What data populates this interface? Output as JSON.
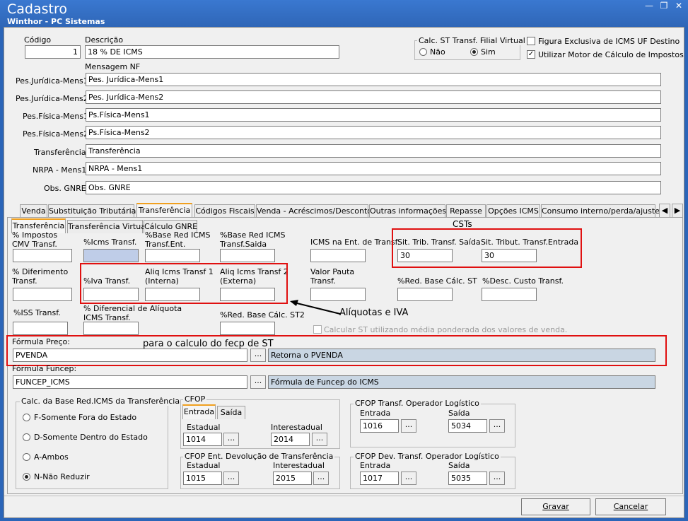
{
  "window": {
    "title": "Cadastro",
    "subtitle": "Winthor - PC Sistemas",
    "minimize": "—",
    "restore": "❐",
    "close": "✕"
  },
  "header": {
    "codigo_label": "Código",
    "codigo_value": "1",
    "descricao_label": "Descrição",
    "descricao_value": "18 % DE ICMS",
    "calc_st_label": "Calc. ST Transf. Filial Virtual",
    "nao_label": "Não",
    "sim_label": "Sim",
    "figura_label": "Figura Exclusiva de ICMS UF Destino",
    "motor_label": "Utilizar Motor de Cálculo de Impostos",
    "check_mark": "✓"
  },
  "mensagens": {
    "title": "Mensagem NF",
    "rows": [
      {
        "label": "Pes.Jurídica-Mens1",
        "value": "Pes. Jurídica-Mens1"
      },
      {
        "label": "Pes.Jurídica-Mens2",
        "value": "Pes. Jurídica-Mens2"
      },
      {
        "label": "Pes.Física-Mens1",
        "value": "Ps.Física-Mens1"
      },
      {
        "label": "Pes.Física-Mens2",
        "value": "Ps.Física-Mens2"
      },
      {
        "label": "Transferência",
        "value": "Transferência"
      },
      {
        "label": "NRPA - Mens1",
        "value": "NRPA - Mens1"
      },
      {
        "label": "Obs. GNRE",
        "value": "Obs. GNRE"
      }
    ]
  },
  "main_tabs": [
    "Venda",
    "Substituição Tributária",
    "Transferência",
    "Códigos Fiscais",
    "Venda - Acréscimos/Descontos",
    "Outras informações",
    "Repasse",
    "Opções ICMS",
    "Consumo interno/perda/ajuste"
  ],
  "scroll": {
    "left": "◀",
    "right": "▶"
  },
  "sub_tabs": [
    "Transferência",
    "Transferência Virtual",
    "Cálculo GNRE"
  ],
  "fields": {
    "impostos_cmv": "% Impostos\nCMV Transf.",
    "icms_transf": "%Icms Transf.",
    "base_red_ent": "%Base Red ICMS\nTransf.Ent.",
    "base_red_saida": "%Base Red ICMS\nTransf.Saida",
    "icms_ent": "ICMS na Ent. de Transf.",
    "sit_trib_saida": "Sit. Trib. Transf. Saída",
    "sit_trib_saida_value": "30",
    "sit_trib_entrada": "Sit. Tribut. Transf.Entrada",
    "sit_trib_entrada_value": "30",
    "diferimento": "% Diferimento\nTransf.",
    "iva_transf": "%Iva Transf.",
    "aliq_interna": "Aliq Icms Transf 1\n(Interna)",
    "aliq_externa": "Aliq Icms Transf 2\n(Externa)",
    "valor_pauta": "Valor Pauta\nTransf.",
    "red_base_st": "%Red. Base Cálc. ST",
    "desc_custo": "%Desc. Custo Transf.",
    "iss_transf": "%ISS  Transf.",
    "diferencial": "% Diferencial de Alíquota\nICMS Transf.",
    "red_base_st2": "%Red. Base Cálc. ST2",
    "calc_st_media": "Calcular ST utilizando média ponderada dos valores de venda."
  },
  "annotations": {
    "csts": "CSTs",
    "aliquotas": "Alíquotas e IVA",
    "fecp": "para o calculo do fecp de ST"
  },
  "formula_preco": {
    "label": "Fórmula Preço:",
    "value": "PVENDA",
    "button": "...",
    "desc": "Retorna o PVENDA"
  },
  "formula_funcep": {
    "label": "Fórmula Funcep:",
    "value": "FUNCEP_ICMS",
    "button": "...",
    "desc": "Fórmula de Funcep do ICMS"
  },
  "calc_base": {
    "title": "Calc. da Base Red.ICMS da Transferência",
    "options": [
      "F-Somente Fora do Estado",
      "D-Somente Dentro do Estado",
      "A-Ambos",
      "N-Não Reduzir"
    ],
    "selected": "N-Não Reduzir"
  },
  "cfop": {
    "title": "CFOP",
    "tabs": [
      "Entrada",
      "Saída"
    ],
    "estadual_label": "Estadual",
    "estadual_value": "1014",
    "interestadual_label": "Interestadual",
    "interestadual_value": "2014",
    "button": "..."
  },
  "cfop_dev": {
    "title": "CFOP Ent. Devolução de Transferência",
    "estadual_label": "Estadual",
    "estadual_value": "1015",
    "interestadual_label": "Interestadual",
    "interestadual_value": "2015"
  },
  "cfop_log": {
    "title": "CFOP Transf. Operador Logístico",
    "entrada_label": "Entrada",
    "entrada_value": "1016",
    "saida_label": "Saída",
    "saida_value": "5034"
  },
  "cfop_dev_log": {
    "title": "CFOP Dev. Transf. Operador Logístico",
    "entrada_label": "Entrada",
    "entrada_value": "1017",
    "saida_label": "Saída",
    "saida_value": "5035"
  },
  "footer": {
    "gravar": "Gravar",
    "cancelar": "Cancelar"
  }
}
